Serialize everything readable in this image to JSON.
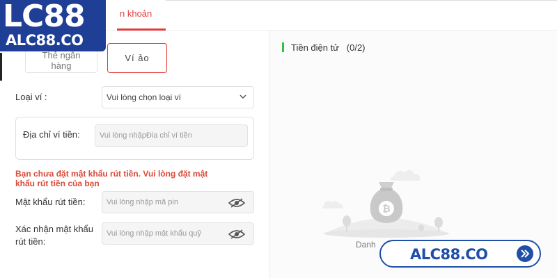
{
  "header": {
    "tab_account_partial": "n khoản"
  },
  "logo": {
    "main": "LC88",
    "sub": "ALC88.CO"
  },
  "methods": {
    "bank_label": "Thẻ ngân hàng",
    "wallet_label": "Ví ảo",
    "selected": "wallet"
  },
  "form": {
    "wallet_type_label": "Loại ví :",
    "wallet_type_placeholder": "Vui lòng chọn loại ví",
    "address_label": "Địa chỉ ví tiền:",
    "address_placeholder": "Vui lòng nhậpĐia chỉ ví tiền",
    "warning": "Bạn chưa đặt mật khẩu rút tiền. Vui lòng đặt mật khẩu rút tiền của bạn",
    "pin_label": "Mật khẩu rút tiền:",
    "pin_placeholder": "Vui lòng nhập mã pin",
    "confirm_label": "Xác nhận mật khẩu rút tiền:",
    "confirm_placeholder": "Vui lòng nhập mật khẩu quỹ"
  },
  "crypto": {
    "title": "Tiền điện tử",
    "count": "(0/2)",
    "empty_text": "Danh"
  },
  "site_button": {
    "label": "ALC88.CO"
  },
  "colors": {
    "accent_red": "#e23b3b",
    "brand_blue": "#1f3e95",
    "green": "#2ec04b"
  }
}
